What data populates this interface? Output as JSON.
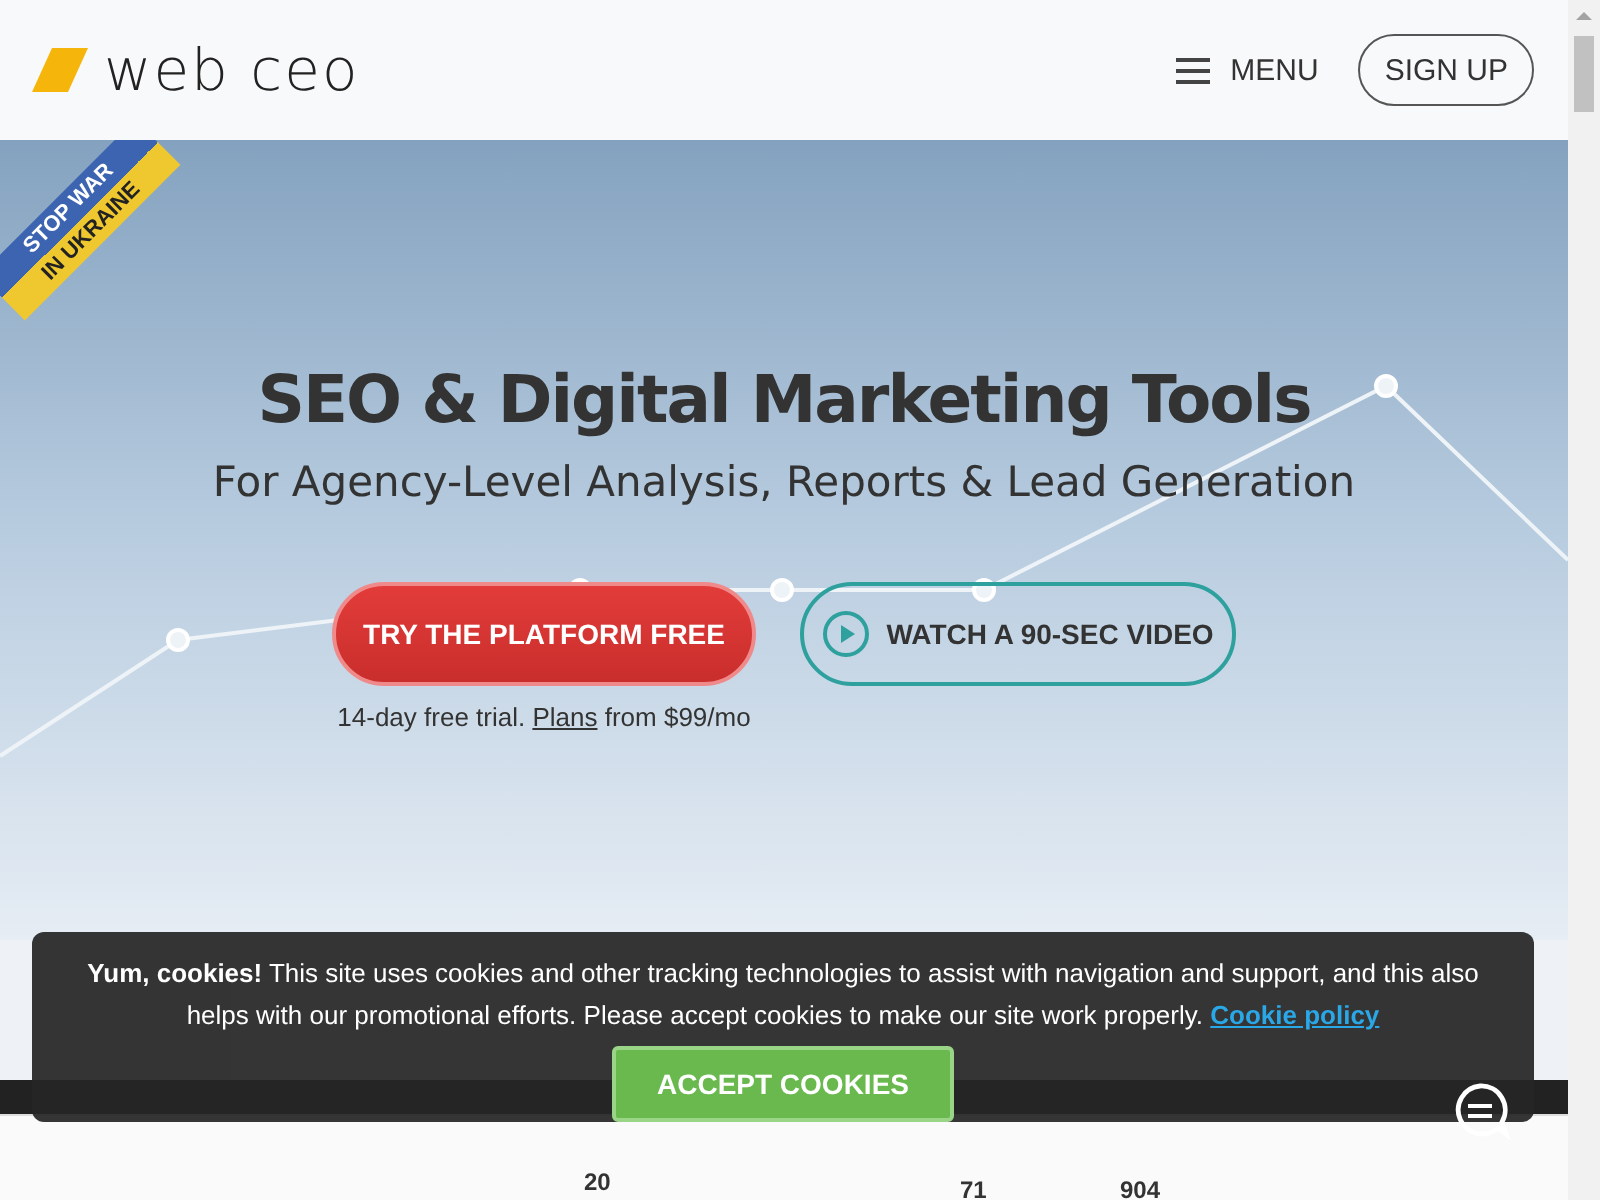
{
  "header": {
    "logo": "web ceo",
    "menu_label": "MENU",
    "signup": "SIGN UP"
  },
  "ribbon": {
    "line1": "STOP WAR",
    "line2": "IN UKRAINE"
  },
  "hero": {
    "title": "SEO & Digital Marketing Tools",
    "subtitle": "For Agency-Level Analysis, Reports & Lead Generation",
    "primary_button": "TRY THE PLATFORM FREE",
    "video_button": "WATCH A 90-SEC VIDEO",
    "note_before": "14-day free trial.",
    "note_link": "Plans",
    "note_after": "from $99/mo"
  },
  "dashboard_preview": {
    "metrics": [
      "20",
      "71",
      "904"
    ]
  },
  "cookie_banner": {
    "text": "**Yum, cookies!** This site uses cookies and other tracking technologies to assist with navigation and support, and this also helps with our promotional efforts. Please accept cookies to make our site work properly.",
    "link": "Cookie policy",
    "button": "ACCEPT COOKIES"
  }
}
